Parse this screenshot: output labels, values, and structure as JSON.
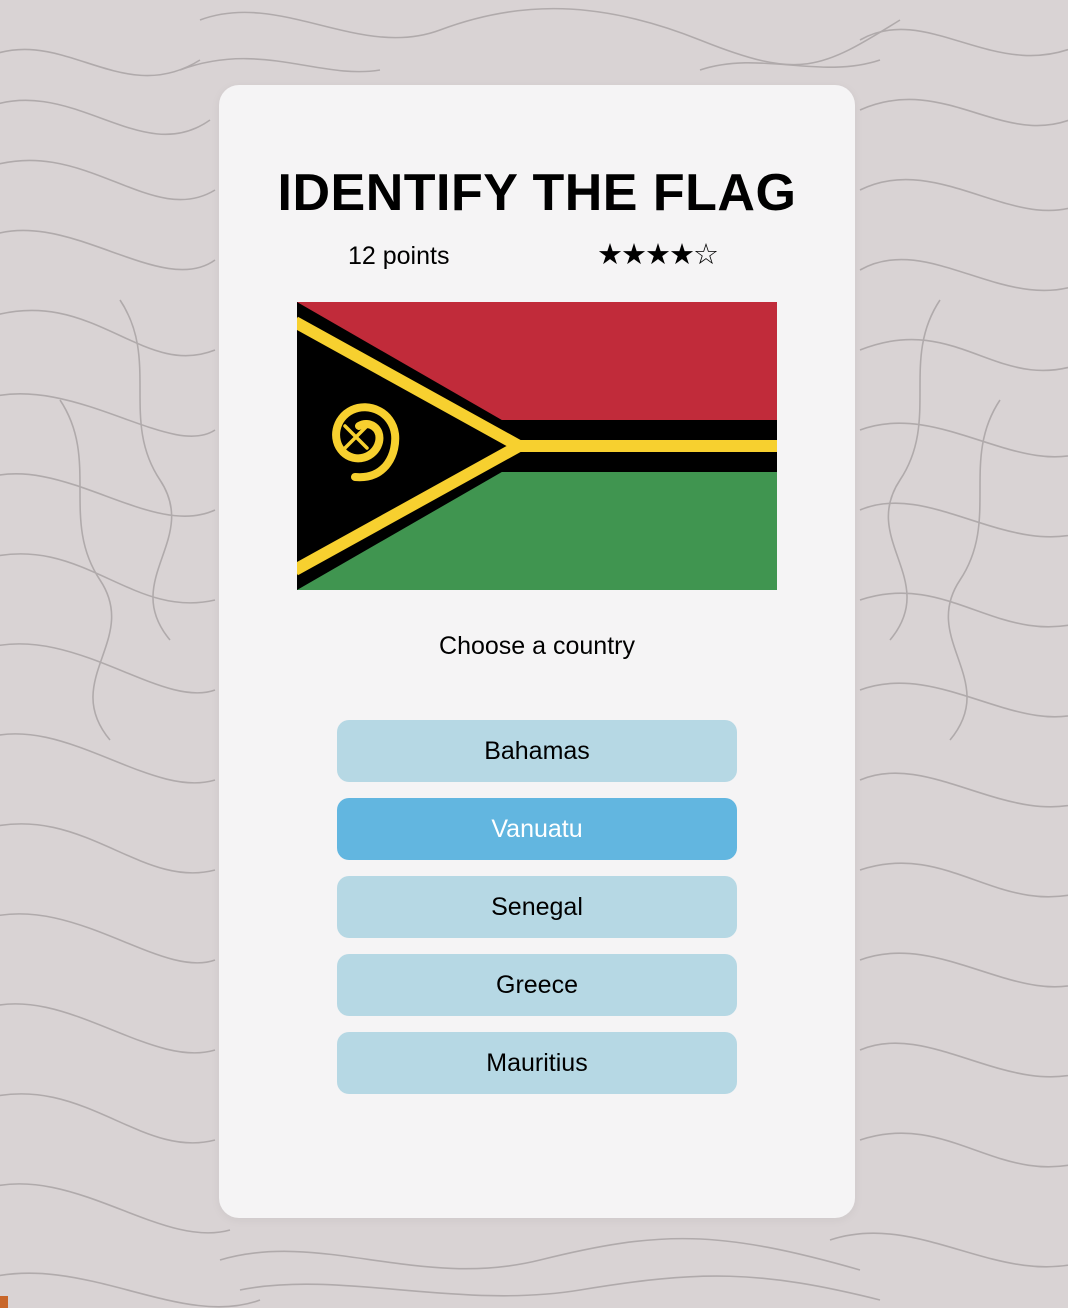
{
  "game": {
    "title": "IDENTIFY THE FLAG",
    "points_label": "12 points",
    "rating": 4,
    "rating_max": 5,
    "prompt": "Choose a country",
    "flag": {
      "country": "Vanuatu",
      "colors": {
        "red": "#c12b3a",
        "green": "#409550",
        "black": "#000000",
        "yellow": "#f7d02f"
      }
    },
    "options": [
      {
        "label": "Bahamas",
        "selected": false
      },
      {
        "label": "Vanuatu",
        "selected": true
      },
      {
        "label": "Senegal",
        "selected": false
      },
      {
        "label": "Greece",
        "selected": false
      },
      {
        "label": "Mauritius",
        "selected": false
      }
    ]
  },
  "theme": {
    "background": "#d9d3d4",
    "card": "#f5f4f5",
    "option_bg": "#b6d8e4",
    "option_selected_bg": "#62b6e0"
  }
}
